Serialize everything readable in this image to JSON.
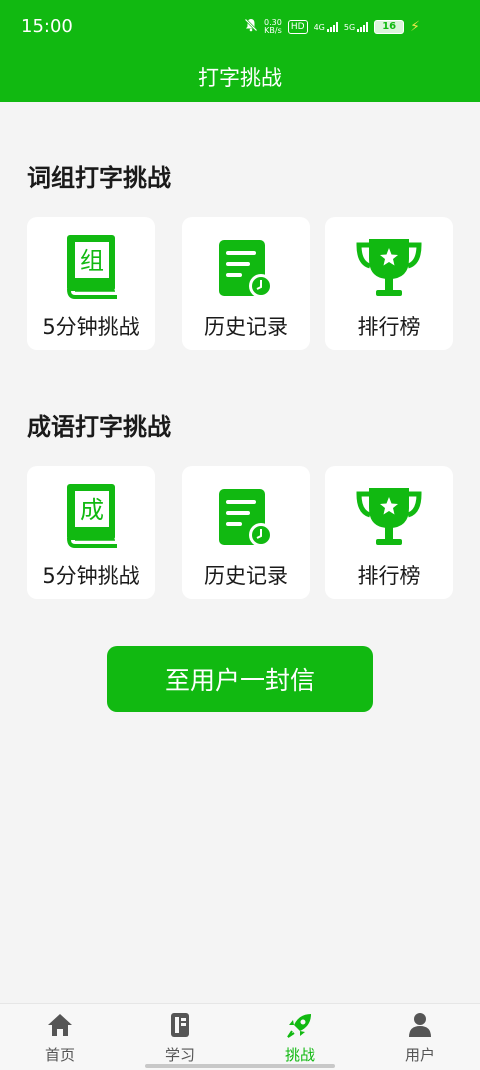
{
  "status": {
    "time": "15:00",
    "speed_top": "0.30",
    "speed_bottom": "KB/s",
    "hd": "HD",
    "net1": "4G",
    "net2": "5G",
    "battery": "16"
  },
  "header": {
    "title": "打字挑战"
  },
  "word_section": {
    "title": "词组打字挑战",
    "book_char": "组",
    "cards": [
      {
        "label": "5分钟挑战"
      },
      {
        "label": "历史记录"
      },
      {
        "label": "排行榜"
      }
    ]
  },
  "idiom_section": {
    "title": "成语打字挑战",
    "book_char": "成",
    "cards": [
      {
        "label": "5分钟挑战"
      },
      {
        "label": "历史记录"
      },
      {
        "label": "排行榜"
      }
    ]
  },
  "letter_button": {
    "label": "至用户一封信"
  },
  "tabs": [
    {
      "label": "首页"
    },
    {
      "label": "学习"
    },
    {
      "label": "挑战"
    },
    {
      "label": "用户"
    }
  ],
  "active_tab": "挑战",
  "colors": {
    "accent": "#11b911",
    "background": "#f4f4f4",
    "card": "#ffffff"
  }
}
